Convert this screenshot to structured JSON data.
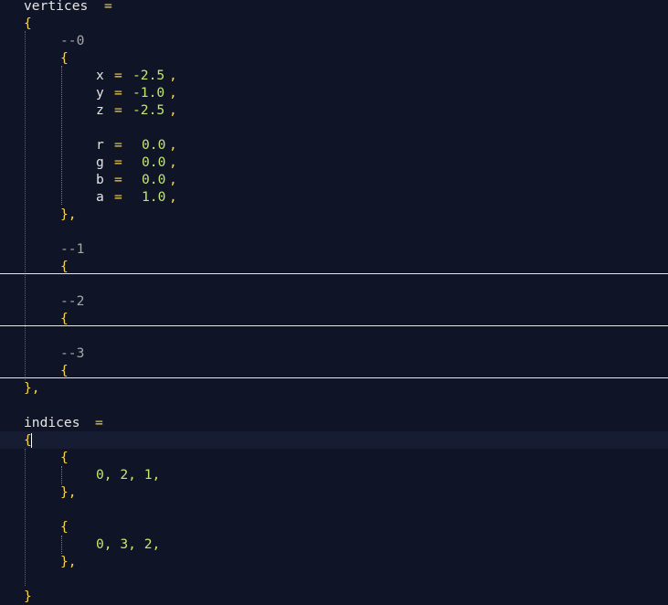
{
  "colors": {
    "background": "#0f1426",
    "identifier": "#e6e6e6",
    "operator": "#f5d547",
    "number": "#c3e86f",
    "comment": "#a8a8a8"
  },
  "code": {
    "vertices": {
      "name": "vertices",
      "assign": "=",
      "open": "{",
      "close": "},",
      "v0": {
        "comment": "--0",
        "open": "{",
        "close": "},",
        "fields": [
          {
            "key": "x",
            "eq": "=",
            "value": "-2.5",
            "comma": ","
          },
          {
            "key": "y",
            "eq": "=",
            "value": "-1.0",
            "comma": ","
          },
          {
            "key": "z",
            "eq": "=",
            "value": "-2.5",
            "comma": ","
          },
          {
            "key": "r",
            "eq": "=",
            "value": "0.0",
            "comma": ","
          },
          {
            "key": "g",
            "eq": "=",
            "value": "0.0",
            "comma": ","
          },
          {
            "key": "b",
            "eq": "=",
            "value": "0.0",
            "comma": ","
          },
          {
            "key": "a",
            "eq": "=",
            "value": "1.0",
            "comma": ","
          }
        ]
      },
      "v1": {
        "comment": "--1",
        "open": "{"
      },
      "v2": {
        "comment": "--2",
        "open": "{"
      },
      "v3": {
        "comment": "--3",
        "open": "{"
      }
    },
    "indices": {
      "name": "indices",
      "assign": "=",
      "open": "{",
      "close": "}",
      "groups": [
        {
          "open": "{",
          "values": "0, 2, 1,",
          "close": "},"
        },
        {
          "open": "{",
          "values": "0, 3, 2,",
          "close": "},"
        }
      ]
    }
  }
}
